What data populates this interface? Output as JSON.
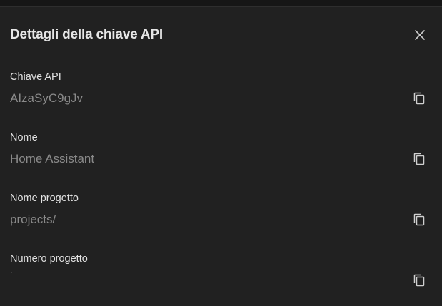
{
  "dialog": {
    "title": "Dettagli della chiave API",
    "close_icon": "close-icon"
  },
  "fields": [
    {
      "label": "Chiave API",
      "value": "AIzaSyC9gJv",
      "icon": "copy-icon"
    },
    {
      "label": "Nome",
      "value": "Home Assistant",
      "icon": "copy-icon"
    },
    {
      "label": "Nome progetto",
      "value": "projects/",
      "icon": "copy-icon"
    },
    {
      "label": "Numero progetto",
      "value": ".",
      "icon": "copy-icon"
    }
  ],
  "colors": {
    "background": "#212121",
    "title": "#e6e6e6",
    "label": "#e2e2e2",
    "value": "#8a8a8a",
    "icon": "#d0d0d0"
  }
}
